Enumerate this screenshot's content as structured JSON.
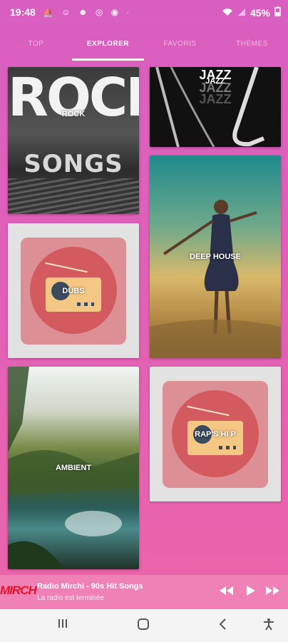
{
  "status": {
    "time": "19:48",
    "notif_icons": "⛵ ☺ ☻ ◎ ◉ ·",
    "battery": "45%"
  },
  "tabs": [
    {
      "label": "TOP"
    },
    {
      "label": "EXPLORER"
    },
    {
      "label": "FAVORIS"
    },
    {
      "label": "THÈMES"
    }
  ],
  "active_tab": "EXPLORER",
  "genres": {
    "rock": {
      "label": "ROCK",
      "art_line1": "ROCK",
      "art_line2": "SONGS"
    },
    "jazz": {
      "label": "JAZZ",
      "art_line": "JAZZ"
    },
    "deep_house": {
      "label": "DEEP HOUSE"
    },
    "dubstep": {
      "label": "DUBS"
    },
    "ambient": {
      "label": "AMBIENT"
    },
    "rap": {
      "label": "RAP'S HI P"
    }
  },
  "player": {
    "logo": "MIRCH",
    "title": "Radio Mirchi - 90s Hit Songs",
    "subtitle": "La radio est terminée"
  },
  "colors": {
    "accent": "#e060b8",
    "player_bg": "#f081b6",
    "radio_icon_bg": "#d35b5f",
    "radio_body": "#f5c785"
  }
}
